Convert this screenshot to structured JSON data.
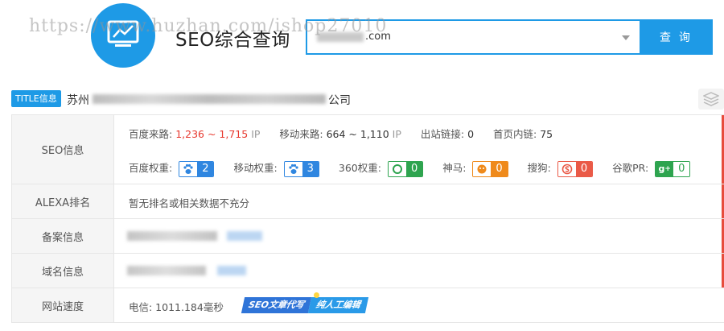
{
  "watermark": "https://www.huzhan.com/ishop27010",
  "header": {
    "app_title": "SEO综合查询",
    "search_value_suffix": ".com",
    "search_button": "查 询"
  },
  "title_row": {
    "badge": "TITLE信息",
    "prefix": "苏州",
    "suffix": "公司"
  },
  "seo": {
    "label": "SEO信息",
    "baidu_traffic_label": "百度来路:",
    "baidu_traffic_value": "1,236 ~ 1,715",
    "baidu_traffic_unit": "IP",
    "mobile_traffic_label": "移动来路:",
    "mobile_traffic_value": "664 ~ 1,110",
    "mobile_traffic_unit": "IP",
    "outbound_label": "出站链接:",
    "outbound_value": "0",
    "inner_label": "首页内链:",
    "inner_value": "75",
    "ranks": {
      "baidu_label": "百度权重:",
      "baidu_value": "2",
      "mobile_label": "移动权重:",
      "mobile_value": "3",
      "s360_label": "360权重:",
      "s360_value": "0",
      "shenma_label": "神马:",
      "shenma_value": "0",
      "sogou_label": "搜狗:",
      "sogou_value": "0",
      "google_label": "谷歌PR:",
      "google_value": "0"
    }
  },
  "alexa": {
    "label": "ALEXA排名",
    "value": "暂无排名或相关数据不充分"
  },
  "beian": {
    "label": "备案信息"
  },
  "domain": {
    "label": "域名信息"
  },
  "speed": {
    "label": "网站速度",
    "value": "电信: 1011.184毫秒",
    "promo_1": "SEO文章代写",
    "promo_2": "纯人工编辑"
  },
  "colors": {
    "brand_blue": "#1e9ae6",
    "accent_red": "#e74c3c",
    "traffic_red": "#e7382e"
  }
}
